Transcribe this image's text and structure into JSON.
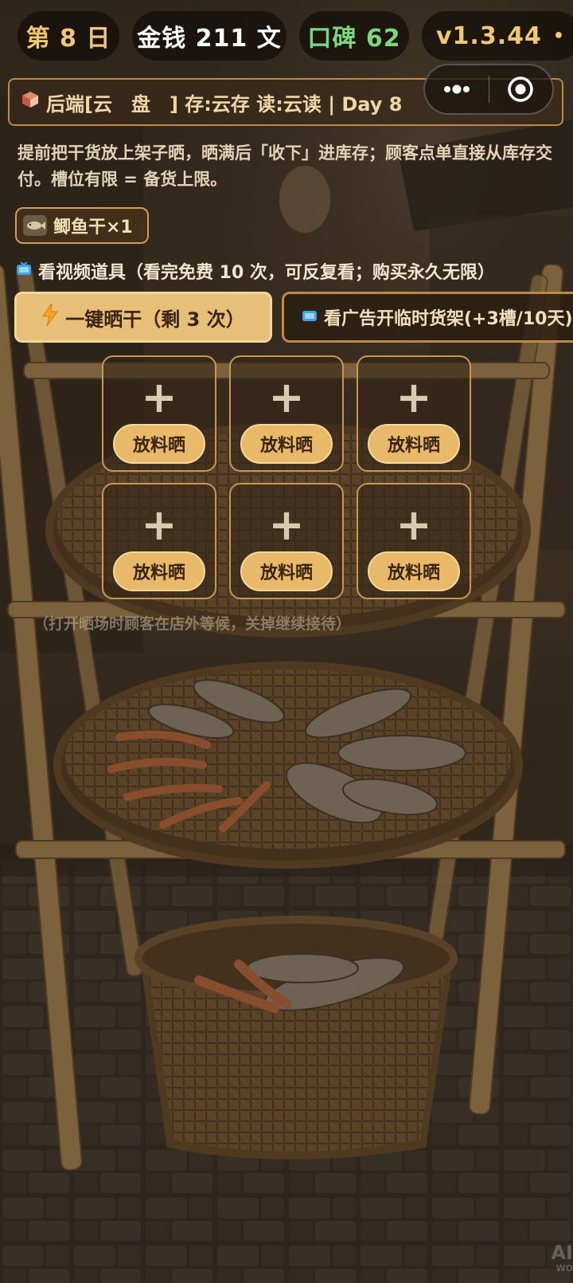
{
  "status": {
    "day": "第 8 日",
    "money": "金钱 211 文",
    "reputation": "口碑 62",
    "version": "v1.3.44",
    "version_dot": "•"
  },
  "colors": {
    "money_text": "#ffffff",
    "day_text": "#f0c774",
    "reputation_text": "#7ed57f",
    "version_text": "#f0c774",
    "accent": "#e7bf78"
  },
  "header_card": {
    "icon": "package-icon",
    "text": "后端[云　盘͏　] 存:云存 读:云读 | Day 8"
  },
  "capsule": {
    "menu_icon": "more-dots-icon",
    "close_icon": "target-circle-icon"
  },
  "description": "提前把干货放上架子晒，晒满后「收下」进库存；顾客点单直接从库存交付。槽位有限 = 备货上限。",
  "inventory": [
    {
      "icon": "fish-icon",
      "label": "鲫鱼干×1"
    }
  ],
  "video_tools": {
    "icon": "tv-icon",
    "title": "看视频道具（看完免费 10 次，可反复看；购买永久无限）"
  },
  "actions": {
    "quick_dry": {
      "icon": "lightning-icon",
      "label": "一键晒干（剩 3 次）"
    },
    "ad_shelf": {
      "icon": "tv-icon",
      "label": "看广告开临时货架(+3槽/10天)"
    }
  },
  "slots": [
    {
      "plus": "+",
      "button": "放料晒"
    },
    {
      "plus": "+",
      "button": "放料晒"
    },
    {
      "plus": "+",
      "button": "放料晒"
    },
    {
      "plus": "+",
      "button": "放料晒"
    },
    {
      "plus": "+",
      "button": "放料晒"
    },
    {
      "plus": "+",
      "button": "放料晒"
    }
  ],
  "note": "（打开晒场时顾客在店外等候，关掉继续接待）",
  "watermark": {
    "main": "AI",
    "sub": "WO"
  }
}
